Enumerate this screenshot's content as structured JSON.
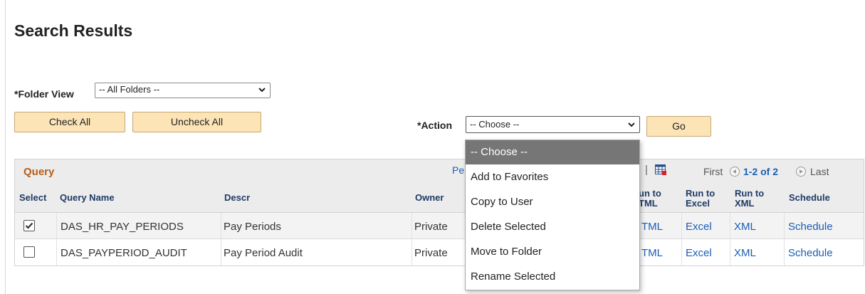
{
  "page": {
    "title": "Search Results"
  },
  "folder_view": {
    "label": "*Folder View",
    "value": "-- All Folders --"
  },
  "buttons": {
    "check_all": "Check All",
    "uncheck_all": "Uncheck All",
    "go": "Go"
  },
  "action": {
    "label": "*Action",
    "value": "-- Choose --"
  },
  "dropdown": {
    "options": [
      "-- Choose --",
      "Add to Favorites",
      "Copy to User",
      "Delete Selected",
      "Move to Folder",
      "Rename Selected"
    ],
    "selected_index": 0
  },
  "grid": {
    "title": "Query",
    "personalize_partial": "Pe",
    "nav": {
      "first": "First",
      "count": "1-2 of 2",
      "last": "Last"
    },
    "columns": {
      "select": "Select",
      "query_name": "Query Name",
      "descr": "Descr",
      "owner": "Owner",
      "run_html_a": "un to",
      "run_html_b": "TML",
      "run_excel_a": "Run to",
      "run_excel_b": "Excel",
      "run_xml_a": "Run to",
      "run_xml_b": "XML",
      "schedule": "Schedule"
    },
    "rows": [
      {
        "checked": true,
        "query_name": "DAS_HR_PAY_PERIODS",
        "descr": "Pay Periods",
        "owner": "Private",
        "html": "TML",
        "excel": "Excel",
        "xml": "XML",
        "schedule": "Schedule"
      },
      {
        "checked": false,
        "query_name": "DAS_PAYPERIOD_AUDIT",
        "descr": "Pay Period Audit",
        "owner": "Private",
        "html": "TML",
        "excel": "Excel",
        "xml": "XML",
        "schedule": "Schedule"
      }
    ]
  },
  "icons": {
    "chevron": "chevron-down-icon",
    "grid_download": "download-to-excel-icon",
    "prev": "previous-icon",
    "next": "next-icon",
    "check": "checkmark-icon"
  },
  "colors": {
    "button_bg": "#fce4b7",
    "grid_title": "#b65d1a",
    "link": "#1a5fb5",
    "dropdown_selected": "#767676"
  }
}
